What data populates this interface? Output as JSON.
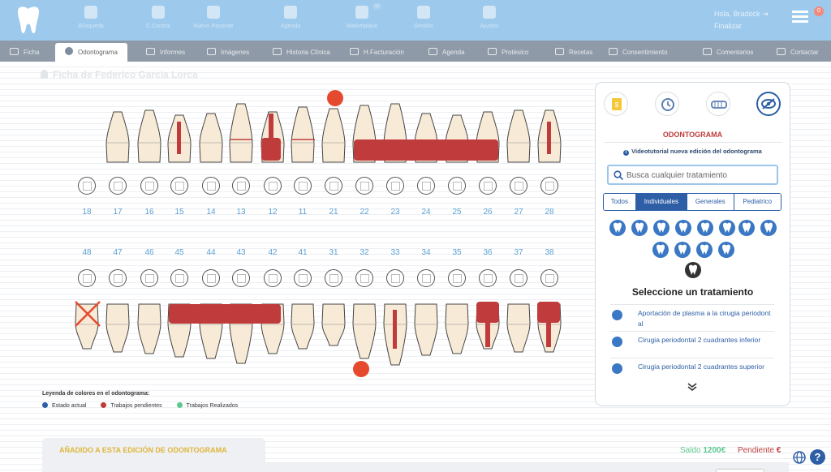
{
  "topbar": {
    "nav": [
      {
        "label": "Búsqueda",
        "icon": "search-icon"
      },
      {
        "label": "C.Control",
        "icon": "tablet-icon"
      },
      {
        "label": "Nuevo Paciente",
        "icon": "add-user-icon"
      },
      {
        "label": "Agenda",
        "icon": "calendar-icon"
      },
      {
        "label": "Marketplace",
        "icon": "basket-icon",
        "badge": "99"
      },
      {
        "label": "Gestión",
        "icon": "org-chart-icon"
      },
      {
        "label": "Ajustes",
        "icon": "gears-icon"
      }
    ],
    "user_line1": "Hola, Bradock",
    "user_line2": "Finalizar",
    "notif_count": "0"
  },
  "tabs": [
    {
      "label": "Ficha",
      "icon": "id-card-icon"
    },
    {
      "label": "Odontograma",
      "icon": "odontogram-icon",
      "active": true
    },
    {
      "label": "Informes",
      "icon": "document-icon"
    },
    {
      "label": "Imágenes",
      "icon": "image-icon"
    },
    {
      "label": "Historia Clínica",
      "icon": "history-icon"
    },
    {
      "label": "H.Facturación",
      "icon": "billing-history-icon"
    },
    {
      "label": "Agenda",
      "icon": "agenda-icon"
    },
    {
      "label": "Protésico",
      "icon": "cart-icon"
    },
    {
      "label": "Recetas",
      "icon": "prescription-icon"
    },
    {
      "label": "Consentimiento",
      "icon": "thumbs-up-icon"
    },
    {
      "label": "Comentarios",
      "icon": "comments-icon"
    },
    {
      "label": "Contactar",
      "icon": "phone-icon"
    }
  ],
  "patient_title": "Ficha de Federico Garcia Lorca",
  "odontogram": {
    "upper_numbers": [
      "18",
      "17",
      "16",
      "15",
      "14",
      "13",
      "12",
      "11",
      "21",
      "22",
      "23",
      "24",
      "25",
      "26",
      "27",
      "28"
    ],
    "lower_numbers": [
      "48",
      "47",
      "46",
      "45",
      "44",
      "43",
      "42",
      "41",
      "31",
      "32",
      "33",
      "34",
      "35",
      "36",
      "37",
      "38"
    ]
  },
  "legend": {
    "title": "Leyenda de colores en el odontograma:",
    "items": [
      {
        "label": "Estado actual",
        "color": "#2d5ea6"
      },
      {
        "label": "Trabajos pendientes",
        "color": "#c03c3c"
      },
      {
        "label": "Trabajos Realizados",
        "color": "#5cc78e"
      }
    ]
  },
  "added_section_title": "AÑADIDO A ESTA EDICIÓN DE ODONTOGRAMA",
  "balance": {
    "saldo_label": "Saldo",
    "saldo_value": "1200€",
    "pendiente_label": "Pendiente",
    "pendiente_value": "€"
  },
  "panel": {
    "buttons": [
      "budget-icon",
      "history-icon",
      "denture-icon",
      "hide-eye-icon"
    ],
    "title": "ODONTOGRAMA",
    "video_link": "Videotutorial nueva edición del odontograma",
    "search_placeholder": "Busca cualquier tratamiento",
    "filter_tabs": [
      "Todos",
      "Individuales",
      "Generales",
      "Pediatrico"
    ],
    "active_filter": "Individuales",
    "select_heading": "Seleccione un tratamiento",
    "treatments": [
      "Aportación de plasma a la cirugia periodontal",
      "Cirugia periodontal 2 cuadrantes inferior",
      "Cirugia periodontal 2 cuadrantes superior"
    ]
  },
  "colors": {
    "topbar": "#9cc9ec",
    "tabbar": "#8e9aa8",
    "pending": "#c03c3c",
    "accent": "#2d5ea6",
    "tooth": "#f7ead7",
    "marker": "#e64a2e"
  }
}
